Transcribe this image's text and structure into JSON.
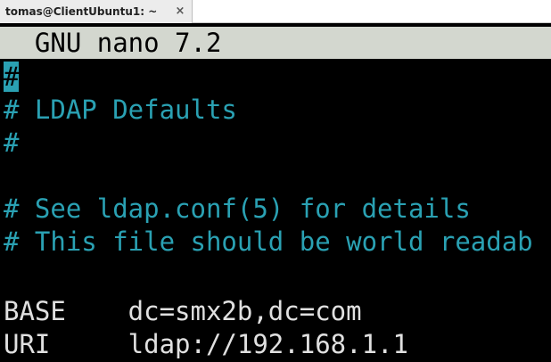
{
  "tab": {
    "title": "tomas@ClientUbuntu1: ~",
    "close_icon": "×"
  },
  "editor": {
    "title": "  GNU nano 7.2",
    "lines": [
      "#",
      "# LDAP Defaults",
      "#",
      "",
      "# See ldap.conf(5) for details",
      "# This file should be world readab",
      "",
      "BASE    dc=smx2b,dc=com",
      "URI     ldap://192.168.1.1"
    ]
  },
  "colors": {
    "comment": "#2aa1b3",
    "text": "#e0e0e0",
    "titlebar_bg": "#d3d7cf",
    "background": "#000000"
  }
}
